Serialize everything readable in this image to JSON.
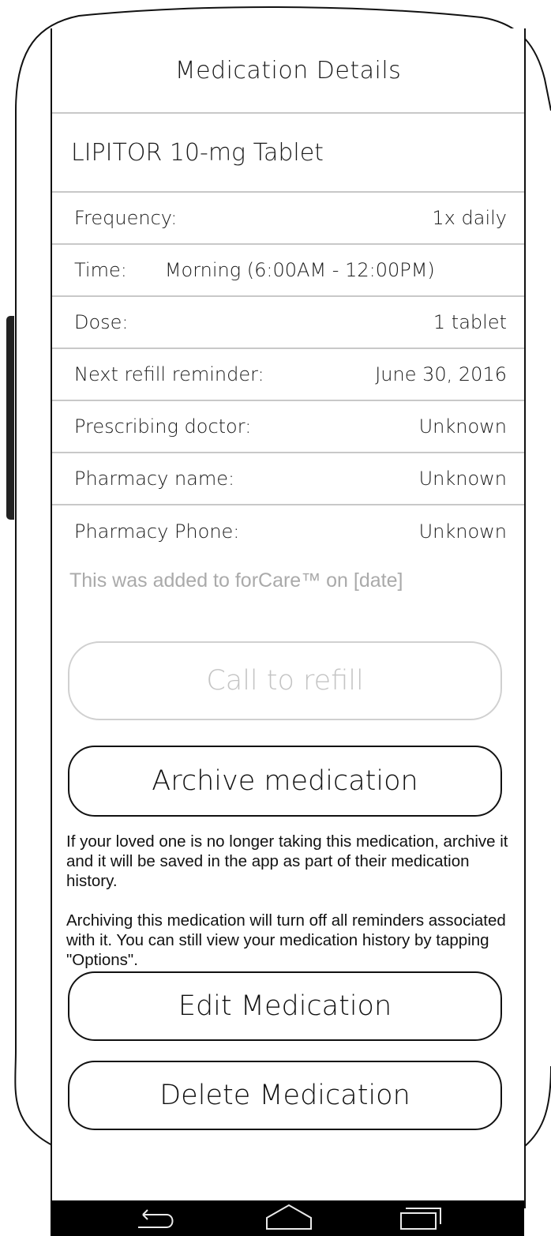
{
  "header": {
    "title": "Medication Details"
  },
  "medication": {
    "name": "LIPITOR 10-mg Tablet"
  },
  "details": [
    {
      "label": "Frequency:",
      "value": "1x daily"
    },
    {
      "label": "Time:",
      "value": "Morning (6:00AM - 12:00PM)"
    },
    {
      "label": "Dose:",
      "value": "1 tablet"
    },
    {
      "label": "Next refill reminder:",
      "value": "June 30, 2016"
    },
    {
      "label": "Prescribing doctor:",
      "value": "Unknown"
    },
    {
      "label": "Pharmacy name:",
      "value": "Unknown"
    },
    {
      "label": "Pharmacy Phone:",
      "value": "Unknown"
    }
  ],
  "added_note": "This was added to forCare™ on [date]",
  "buttons": {
    "call_refill": "Call to refill",
    "archive": "Archive medication",
    "edit": "Edit Medication",
    "delete": "Delete Medication"
  },
  "info": {
    "archive_help": "If your loved one is no longer taking this medication, archive it and it will be saved in the app as part of their medication history.",
    "archive_warning": "Archiving this medication will turn off all reminders associated with it. You can still view your medication history by tapping \"Options\"."
  },
  "navbar": {
    "icons": [
      "back-icon",
      "home-icon",
      "recents-icon"
    ]
  }
}
